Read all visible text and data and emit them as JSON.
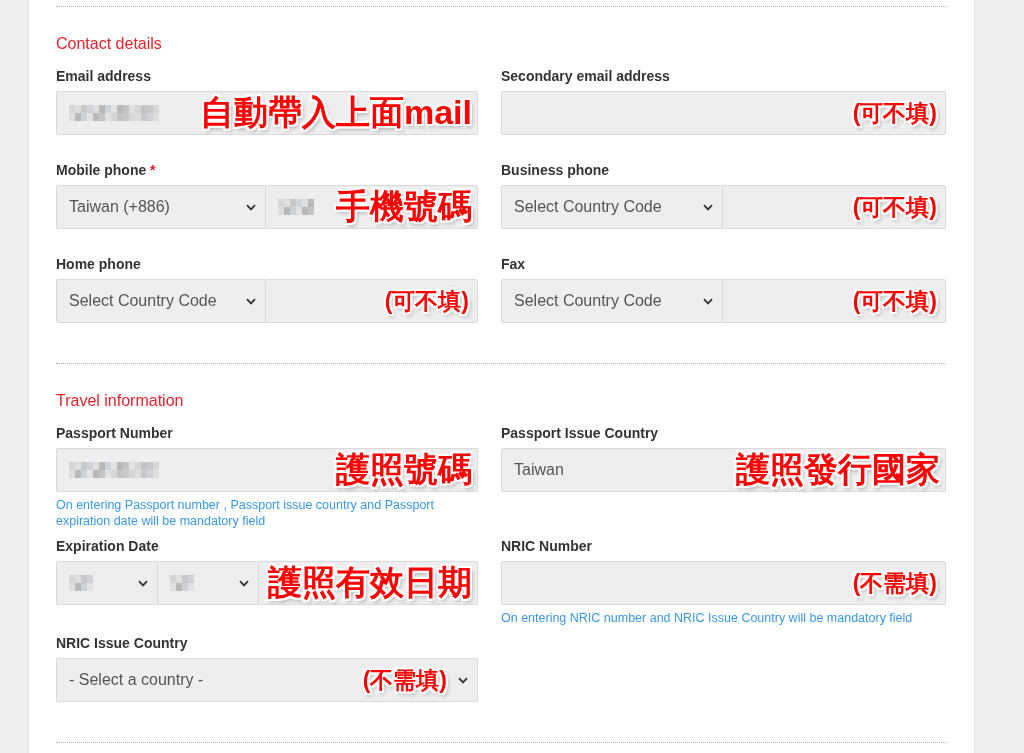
{
  "sections": [
    {
      "title": "Contact details",
      "rows": [
        [
          {
            "label": "Email address",
            "controls": [
              {
                "kind": "input",
                "value_blurred": true
              }
            ],
            "annotation": {
              "kind": "field_name",
              "text": "自動帶入上面mail"
            }
          },
          {
            "label": "Secondary email address",
            "controls": [
              {
                "kind": "input",
                "value_blurred": false
              }
            ],
            "annotation": {
              "kind": "requirement",
              "text": "(可不填)"
            }
          }
        ],
        [
          {
            "label": "Mobile phone",
            "required_mark": "*",
            "controls": [
              {
                "kind": "select",
                "value": "Taiwan (+886)",
                "value_blurred": false
              },
              {
                "kind": "input",
                "value_blurred": true
              }
            ],
            "annotation": {
              "kind": "field_name",
              "text": "手機號碼"
            }
          },
          {
            "label": "Business phone",
            "controls": [
              {
                "kind": "select",
                "placeholder": "Select Country Code",
                "value_blurred": false
              },
              {
                "kind": "input",
                "value_blurred": false
              }
            ],
            "annotation": {
              "kind": "requirement",
              "text": "(可不填)"
            }
          }
        ],
        [
          {
            "label": "Home phone",
            "controls": [
              {
                "kind": "select",
                "placeholder": "Select Country Code",
                "value_blurred": false
              },
              {
                "kind": "input",
                "value_blurred": false
              }
            ],
            "annotation": {
              "kind": "requirement",
              "text": "(可不填)"
            }
          },
          {
            "label": "Fax",
            "controls": [
              {
                "kind": "select",
                "placeholder": "Select Country Code",
                "value_blurred": false
              },
              {
                "kind": "input",
                "value_blurred": false
              }
            ],
            "annotation": {
              "kind": "requirement",
              "text": "(可不填)"
            }
          }
        ]
      ]
    },
    {
      "title": "Travel information",
      "rows": [
        [
          {
            "label": "Passport Number",
            "controls": [
              {
                "kind": "input",
                "value_blurred": true
              }
            ],
            "annotation": {
              "kind": "field_name",
              "text": "護照號碼"
            },
            "help": "On entering Passport number , Passport issue country and Passport expiration date will be mandatory field"
          },
          {
            "label": "Passport Issue Country",
            "controls": [
              {
                "kind": "select",
                "value": "Taiwan",
                "value_blurred": false
              }
            ],
            "annotation": {
              "kind": "field_name",
              "text": "護照發行國家"
            }
          }
        ],
        [
          {
            "label": "Expiration Date",
            "controls": [
              {
                "kind": "select",
                "value_blurred": true
              },
              {
                "kind": "select",
                "value_blurred": true
              },
              {
                "kind": "select",
                "value_blurred": false
              }
            ],
            "annotation": {
              "kind": "field_name",
              "text": "護照有效日期"
            }
          },
          {
            "label": "NRIC Number",
            "controls": [
              {
                "kind": "input",
                "value_blurred": false
              }
            ],
            "annotation": {
              "kind": "requirement",
              "text": "(不需填)"
            },
            "help": "On entering NRIC number and NRIC Issue Country will be mandatory field"
          }
        ],
        [
          {
            "label": "NRIC Issue Country",
            "controls": [
              {
                "kind": "select",
                "placeholder": "- Select a country -",
                "value_blurred": false
              }
            ],
            "annotation": {
              "kind": "requirement",
              "text": "(不需填)"
            }
          }
        ]
      ]
    }
  ]
}
